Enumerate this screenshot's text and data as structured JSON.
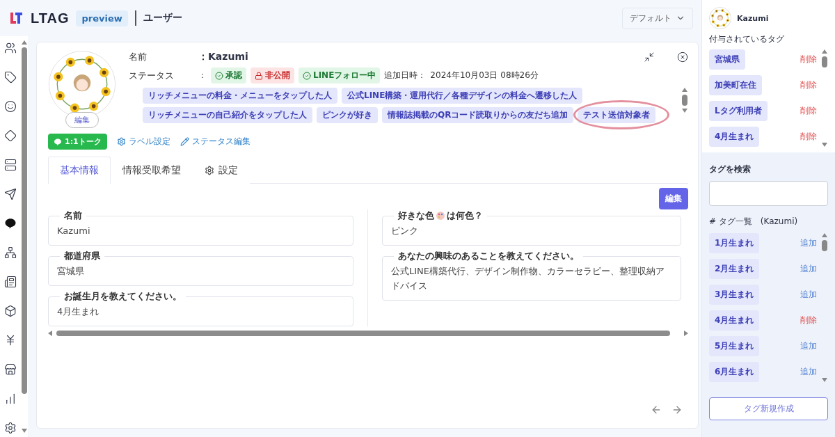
{
  "header": {
    "logo": "LTAG",
    "badge": "preview",
    "page_title": "ユーザー",
    "view_select": "デフォルト"
  },
  "profile": {
    "avatar_edit": "編集",
    "name_label": "名前",
    "name_value": "：Kazumi",
    "status_label": "ステータス",
    "status_sep": "：",
    "badges": [
      {
        "text": "承認",
        "kind": "approved"
      },
      {
        "text": "非公開",
        "kind": "private"
      },
      {
        "text": "LINEフォロー中",
        "kind": "follow"
      }
    ],
    "added_label": "追加日時：",
    "added_value": "2024年10月03日 08時26分",
    "tags": [
      {
        "text": "リッチメニューの料金・メニューをタップした人",
        "highlighted": false
      },
      {
        "text": "公式LINE構築・運用代行／各種デザインの料金へ遷移した人",
        "highlighted": false
      },
      {
        "text": "リッチメニューの自己紹介をタップした人",
        "highlighted": false
      },
      {
        "text": "ピンクが好き",
        "highlighted": false
      },
      {
        "text": "情報誌掲載のQRコード読取りからの友だち追加",
        "highlighted": false
      },
      {
        "text": "テスト送信対象者",
        "highlighted": true
      }
    ]
  },
  "actions": {
    "talk": "1:1トーク",
    "label_settings": "ラベル設定",
    "status_edit": "ステータス編集"
  },
  "tabs": [
    {
      "label": "基本情報",
      "selected": true,
      "kind": "plain"
    },
    {
      "label": "情報受取希望",
      "selected": false,
      "kind": "plain"
    },
    {
      "label": "設定",
      "selected": false,
      "kind": "settings"
    }
  ],
  "edit_button": "編集",
  "columns": [
    [
      {
        "label": "名前",
        "value": "Kazumi"
      },
      {
        "label": "都道府県",
        "value": "宮城県"
      },
      {
        "label": "お誕生月を教えてください。",
        "value": "4月生まれ"
      }
    ],
    [
      {
        "label": "好きな色",
        "label_after": "は何色？",
        "value": "ピンク"
      },
      {
        "label": "あなたの興味のあることを教えてください。",
        "value": "公式LINE構築代行、デザイン制作物、カラーセラピー、整理収納アドバイス"
      }
    ]
  ],
  "panel": {
    "user": "Kazumi",
    "assigned_title": "付与されているタグ",
    "assigned": [
      {
        "tag": "宮城県",
        "action": "削除",
        "kind": "remove"
      },
      {
        "tag": "加美町在住",
        "action": "削除",
        "kind": "remove"
      },
      {
        "tag": "Lタグ利用者",
        "action": "削除",
        "kind": "remove"
      },
      {
        "tag": "4月生まれ",
        "action": "削除",
        "kind": "remove"
      }
    ],
    "search_title": "タグを検索",
    "list_title": "# タグ一覧　(Kazumi)",
    "list": [
      {
        "tag": "1月生まれ",
        "action": "追加",
        "kind": "add"
      },
      {
        "tag": "2月生まれ",
        "action": "追加",
        "kind": "add"
      },
      {
        "tag": "3月生まれ",
        "action": "追加",
        "kind": "add"
      },
      {
        "tag": "4月生まれ",
        "action": "削除",
        "kind": "remove"
      },
      {
        "tag": "5月生まれ",
        "action": "追加",
        "kind": "add"
      },
      {
        "tag": "6月生まれ",
        "action": "追加",
        "kind": "add"
      }
    ],
    "create_button": "タグ新規作成"
  }
}
